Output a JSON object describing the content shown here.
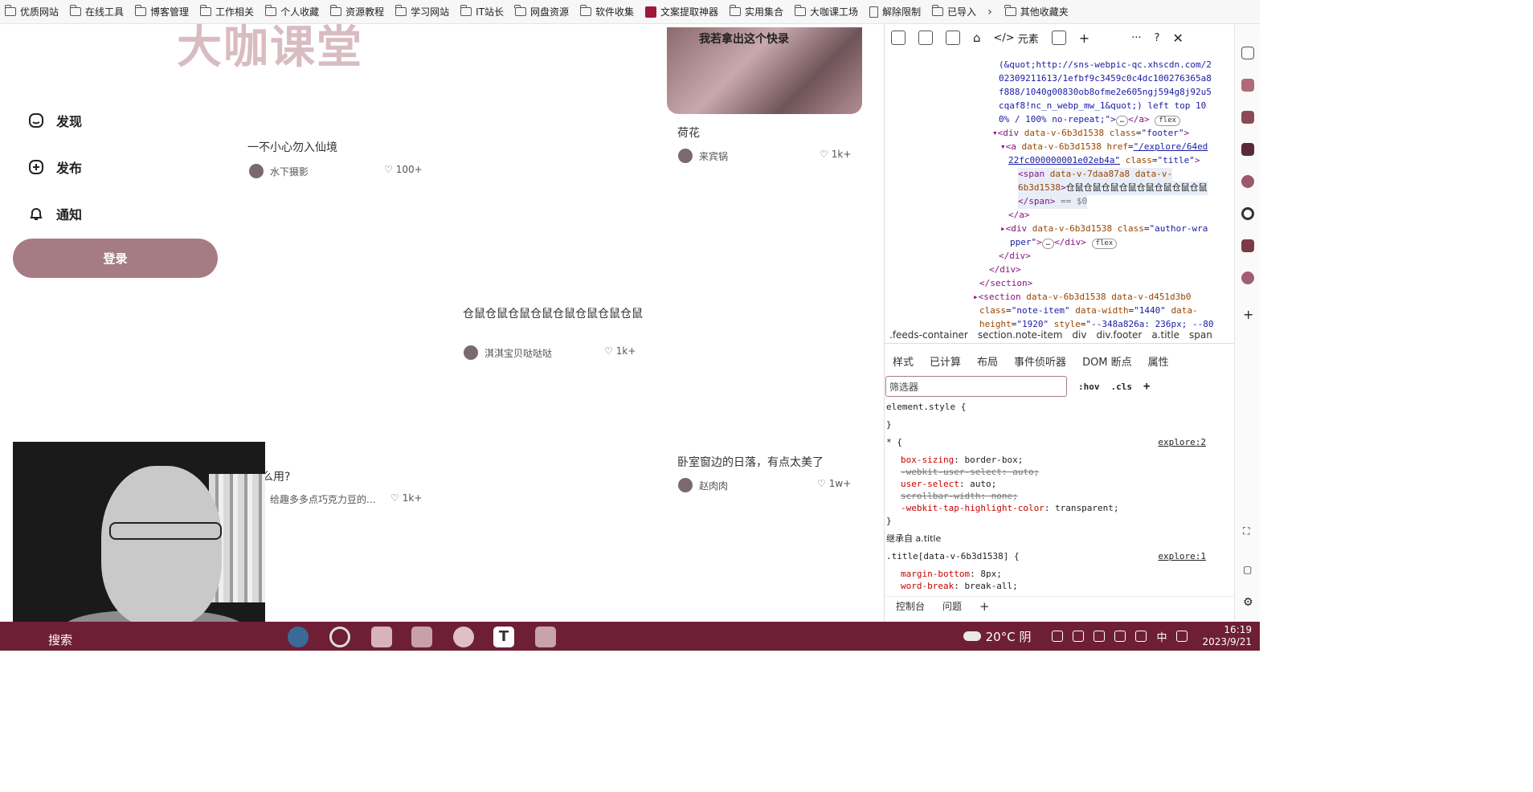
{
  "bookmarks": {
    "items": [
      "优质网站",
      "在线工具",
      "博客管理",
      "工作相关",
      "个人收藏",
      "资源教程",
      "学习网站",
      "IT站长",
      "网盘资源",
      "软件收集",
      "文案提取神器",
      "实用集合",
      "大咖课工场",
      "解除限制",
      "已导入"
    ],
    "more": "其他收藏夹"
  },
  "site": {
    "logo": "大咖课堂",
    "nav": [
      {
        "label": "发现",
        "icon": "home-icon"
      },
      {
        "label": "发布",
        "icon": "plus-icon"
      },
      {
        "label": "通知",
        "icon": "bell-icon"
      }
    ],
    "login": "登录"
  },
  "feed": {
    "cover_text": "我若拿出这个快录",
    "cards": [
      {
        "title": "一不小心勿入仙境",
        "author": "水下摄影",
        "likes": "100+"
      },
      {
        "title": "荷花",
        "author": "来宾锅",
        "likes": "1k+"
      },
      {
        "title": "仓鼠仓鼠仓鼠仓鼠仓鼠仓鼠仓鼠仓鼠",
        "author": "淇淇宝贝哒哒哒",
        "likes": "1k+"
      },
      {
        "title": "卧室窗边的日落，有点太美了",
        "author": "赵肉肉",
        "likes": "1w+"
      },
      {
        "title": "么用?",
        "author": "给趣多多点巧克力豆的...",
        "likes": "1k+"
      }
    ]
  },
  "devtools": {
    "tab_elements": "元素",
    "code_lines": {
      "l1": "(&quot;http://sns-webpic-qc.xhscdn.com/2",
      "l2": "02309211613/1efbf9c3459c0c4dc100276365a8",
      "l3": "f888/1040g00830ob8ofme2e605ngj594g8j92u5",
      "l4": "cqaf8!nc_n_webp_mw_1&quot;) left top 10",
      "l5": "0% / 100% no-repeat;\">",
      "l6_text": "仓鼠仓鼠仓鼠仓鼠仓鼠仓鼠仓鼠仓鼠",
      "eq": "== $0"
    },
    "breadcrumbs": [
      ".feeds-container",
      "section.note-item",
      "div",
      "div.footer",
      "a.title",
      "span"
    ],
    "subtabs": [
      "样式",
      "已计算",
      "布局",
      "事件侦听器",
      "DOM 断点",
      "属性"
    ],
    "filter_placeholder": "筛选器",
    "hov": ":hov",
    "cls": ".cls",
    "styles": {
      "element_style": "element.style {",
      "universal": "* {",
      "src1": "explore:2",
      "p1": "box-sizing",
      "v1": "border-box;",
      "p2": "-webkit-user-select: auto;",
      "p3": "user-select",
      "v3": "auto;",
      "p4": "scrollbar-width: none;",
      "p5": "-webkit-tap-highlight-color",
      "v5": "transparent;",
      "inherited": "继承自",
      "inherited_sel": "a.title",
      "title_sel": ".title[data-v-6b3d1538] {",
      "src2": "explore:1",
      "p6": "margin-bottom",
      "v6": "8px;",
      "p7": "word-break",
      "v7": "break-all;"
    },
    "bottom_tabs": [
      "控制台",
      "问题"
    ]
  },
  "taskbar": {
    "search": "搜索",
    "weather": "20°C 阴",
    "ime": "中",
    "time": "16:19",
    "date": "2023/9/21"
  }
}
